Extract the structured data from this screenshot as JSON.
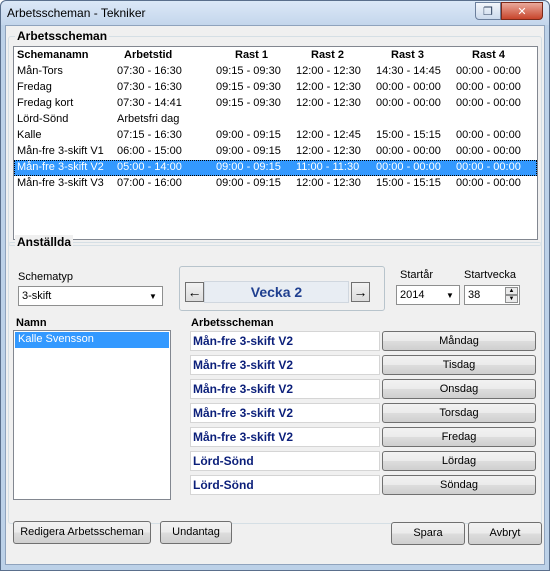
{
  "window": {
    "title": "Arbetsscheman - Tekniker"
  },
  "schedules": {
    "group_title": "Arbetsscheman",
    "columns": [
      "Schemanamn",
      "Arbetstid",
      "Rast 1",
      "Rast 2",
      "Rast 3",
      "Rast 4"
    ],
    "rows": [
      [
        "Mån-Tors",
        "07:30 - 16:30",
        "09:15 - 09:30",
        "12:00 - 12:30",
        "14:30 - 14:45",
        "00:00 - 00:00"
      ],
      [
        "Fredag",
        "07:30 - 16:30",
        "09:15 - 09:30",
        "12:00 - 12:30",
        "00:00 - 00:00",
        "00:00 - 00:00"
      ],
      [
        "Fredag kort",
        "07:30 - 14:41",
        "09:15 - 09:30",
        "12:00 - 12:30",
        "00:00 - 00:00",
        "00:00 - 00:00"
      ],
      [
        "Lörd-Sönd",
        "Arbetsfri dag",
        "",
        "",
        "",
        ""
      ],
      [
        "Kalle",
        "07:15 - 16:30",
        "09:00 - 09:15",
        "12:00 - 12:45",
        "15:00 - 15:15",
        "00:00 - 00:00"
      ],
      [
        "Mån-fre 3-skift V1",
        "06:00 - 15:00",
        "09:00 - 09:15",
        "12:00 - 12:30",
        "00:00 - 00:00",
        "00:00 - 00:00"
      ],
      [
        "Mån-fre 3-skift V2",
        "05:00 - 14:00",
        "09:00 - 09:15",
        "11:00 - 11:30",
        "00:00 - 00:00",
        "00:00 - 00:00"
      ],
      [
        "Mån-fre 3-skift V3",
        "07:00 - 16:00",
        "09:00 - 09:15",
        "12:00 - 12:30",
        "15:00 - 15:15",
        "00:00 - 00:00"
      ]
    ],
    "selected_row": 6
  },
  "employees": {
    "group_title": "Anställda",
    "schematype_label": "Schematyp",
    "schematype_value": "3-skift",
    "week_label": "Vecka 2",
    "startyear_label": "Startår",
    "startyear_value": "2014",
    "startweek_label": "Startvecka",
    "startweek_value": "38",
    "names_header": "Namn",
    "names": [
      "Kalle Svensson"
    ],
    "schedule_header": "Arbetsscheman",
    "days": [
      {
        "schedule": "Mån-fre 3-skift V2",
        "day": "Måndag"
      },
      {
        "schedule": "Mån-fre 3-skift V2",
        "day": "Tisdag"
      },
      {
        "schedule": "Mån-fre 3-skift V2",
        "day": "Onsdag"
      },
      {
        "schedule": "Mån-fre 3-skift V2",
        "day": "Torsdag"
      },
      {
        "schedule": "Mån-fre 3-skift V2",
        "day": "Fredag"
      },
      {
        "schedule": "Lörd-Sönd",
        "day": "Lördag"
      },
      {
        "schedule": "Lörd-Sönd",
        "day": "Söndag"
      }
    ]
  },
  "buttons": {
    "edit": "Redigera Arbetsscheman",
    "exceptions": "Undantag",
    "save": "Spara",
    "cancel": "Avbryt"
  },
  "colors": {
    "selection": "#3399ff",
    "week_text": "#1f3f8f",
    "schedule_text": "#0b1f7a"
  }
}
